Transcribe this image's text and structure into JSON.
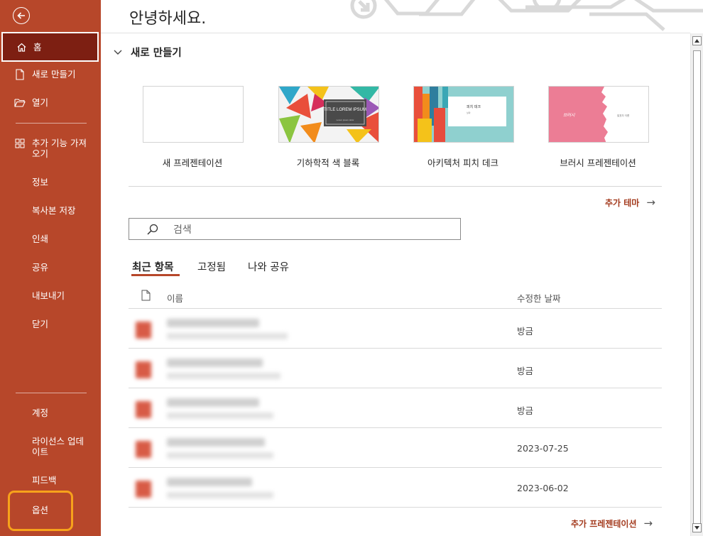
{
  "header": {
    "greeting": "안녕하세요."
  },
  "sidebar": {
    "top_items": [
      {
        "label": "홈",
        "icon": "home-icon",
        "active": true
      },
      {
        "label": "새로 만들기",
        "icon": "new-file-icon"
      },
      {
        "label": "열기",
        "icon": "folder-open-icon"
      }
    ],
    "addins": {
      "label": "추가 기능 가져오기",
      "icon": "addins-grid-icon"
    },
    "middle_items": [
      "정보",
      "복사본 저장",
      "인쇄",
      "공유",
      "내보내기",
      "닫기"
    ],
    "bottom_items": [
      "계정",
      "라이선스 업데이트",
      "피드백",
      "옵션"
    ],
    "colors": {
      "sidebar_bg": "#b7472a",
      "active_bg": "#7d1f12",
      "highlight": "#f7a21b"
    }
  },
  "new_section": {
    "title": "새로 만들기",
    "templates": [
      {
        "label": "새 프레젠테이션"
      },
      {
        "label": "기하학적 색 블록",
        "thumb_title": "TITLE LOREM IPSUM",
        "thumb_subtitle": "Lorem ipsum dolor"
      },
      {
        "label": "아키텍처 피치 데크",
        "thumb_title": "피치 데크",
        "thumb_subtitle": "날짜"
      },
      {
        "label": "브러시 프레젠테이션",
        "thumb_title": "브러시",
        "thumb_subtitle": "발표자 이름"
      }
    ],
    "more_themes": "추가 테마"
  },
  "search": {
    "placeholder": "검색"
  },
  "tabs": [
    "최근 항목",
    "고정됨",
    "나와 공유"
  ],
  "table": {
    "col_name": "이름",
    "col_date": "수정한 날짜",
    "rows": [
      {
        "date": "방금"
      },
      {
        "date": "방금"
      },
      {
        "date": "방금"
      },
      {
        "date": "2023-07-25"
      },
      {
        "date": "2023-06-02"
      }
    ]
  },
  "more_presentations": "추가 프레젠테이션"
}
